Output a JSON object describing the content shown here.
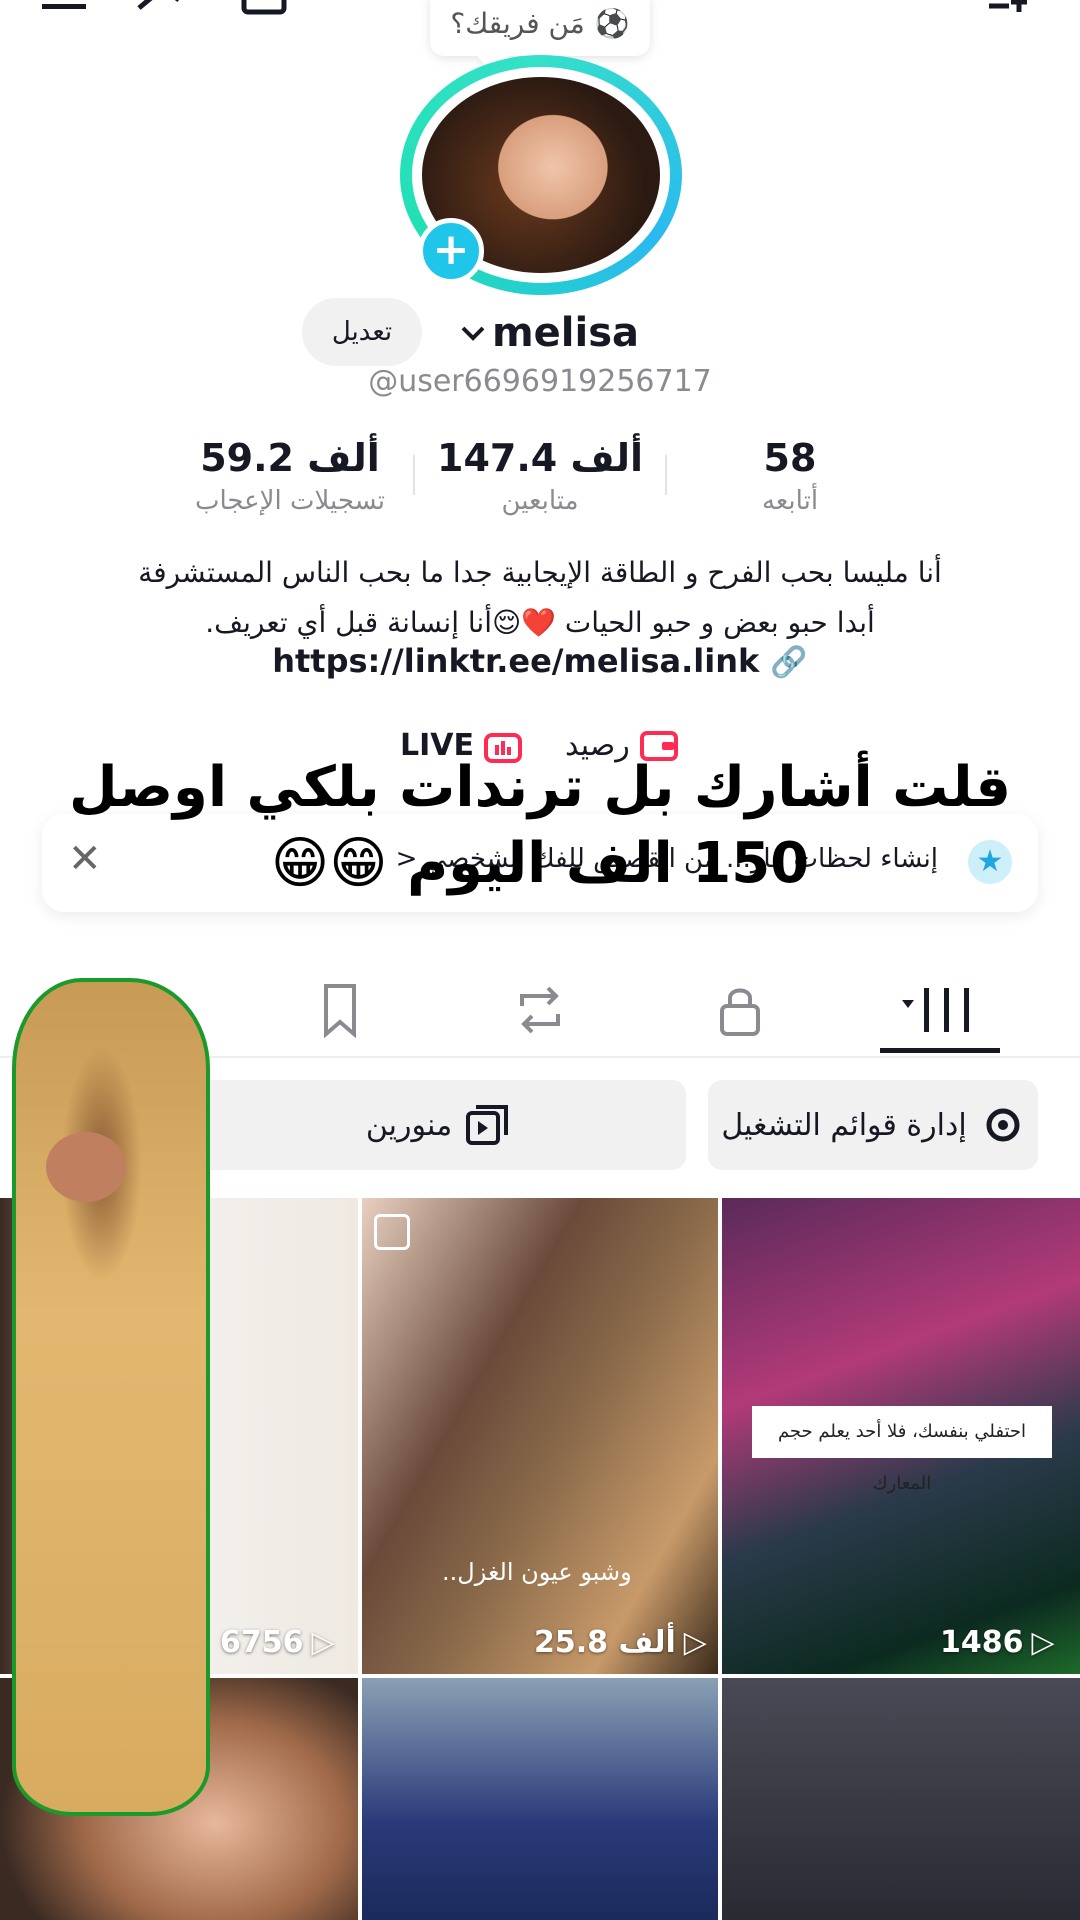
{
  "team_prompt": {
    "label": "مَن فريقك؟",
    "emoji": "⚽"
  },
  "profile": {
    "edit_label": "تعديل",
    "name": "melisa",
    "handle": "@user6696919256717"
  },
  "stats": [
    {
      "value": "58",
      "label": "أتابعه"
    },
    {
      "value": "147.4 ألف",
      "label": "متابعين"
    },
    {
      "value": "59.2 ألف",
      "label": "تسجيلات الإعجاب"
    }
  ],
  "bio": {
    "line1": "أنا مليسا بحب الفرح و الطاقة الإيجابية جدا ما بحب الناس المستشرفة",
    "line2": "أبدا   حبو بعض و حبو الحيات ❤️😌أنا إنسانة قبل أي تعريف.",
    "link": "https://linktr.ee/melisa.link"
  },
  "shortcuts": {
    "balance": "رصيد",
    "live": "LIVE"
  },
  "banner": {
    "text": "إنشاء لحظات مار... من القصص للفك الشخصي <"
  },
  "overlay": {
    "line1": "قلت أشارك بل ترندات بلكي اوصل",
    "line2": "150 الف اليوم 😁😁"
  },
  "playlists": {
    "manage_label": "إدارة قوائم التشغيل",
    "playlist_label": "منورين"
  },
  "grid": [
    {
      "count": "1486"
    },
    {
      "count": "25.8 ألف",
      "caption": "وشبو عيون الغزل.."
    },
    {
      "count": "6756"
    }
  ],
  "tile_caption_banner": "احتفلي بنفسك، فلا أحد يعلم حجم المعارك",
  "colors": {
    "accent": "#20c5ea",
    "ring": "#35e0c9",
    "text": "#161823",
    "muted": "#8a8b91",
    "live": "#fe2c55"
  }
}
